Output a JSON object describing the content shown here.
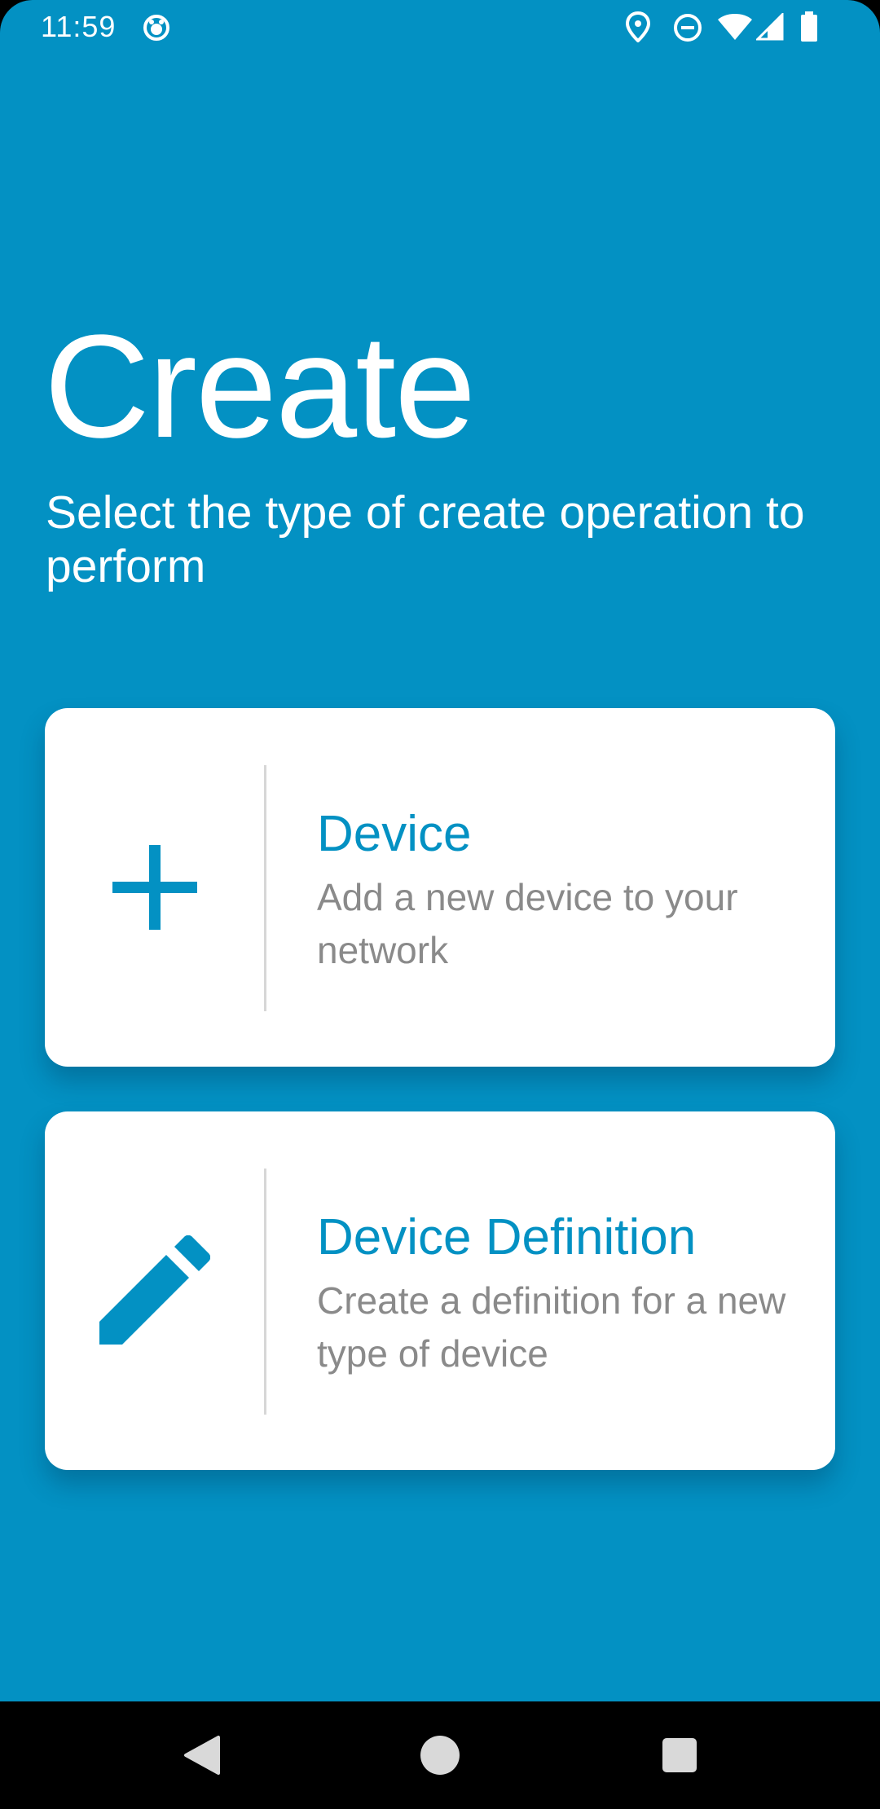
{
  "status_bar": {
    "time": "11:59",
    "icons": [
      "app-notification-icon",
      "location-icon",
      "do-not-disturb-icon",
      "wifi-icon",
      "cell-signal-icon",
      "battery-icon"
    ]
  },
  "header": {
    "title": "Create",
    "subtitle": "Select the type of create operation to perform"
  },
  "options": [
    {
      "icon": "plus-icon",
      "title": "Device",
      "description": "Add a new device to your network"
    },
    {
      "icon": "pencil-icon",
      "title": "Device Definition",
      "description": "Create a definition for a new type of device"
    }
  ],
  "nav_bar": {
    "buttons": [
      "back-icon",
      "home-icon",
      "recents-icon"
    ]
  },
  "colors": {
    "background": "#0391C3",
    "accent": "#0391C3",
    "card": "#FFFFFF",
    "description_text": "#8A8A8A",
    "nav_bar": "#000000"
  }
}
